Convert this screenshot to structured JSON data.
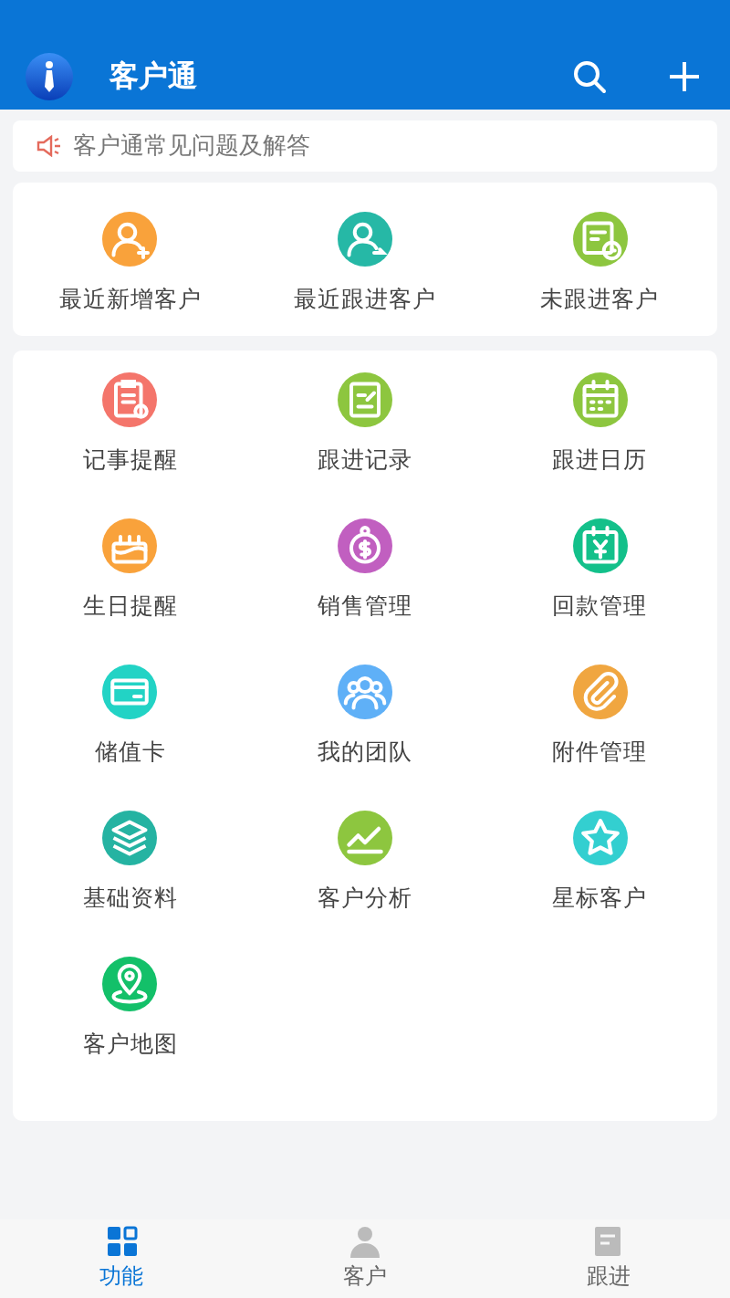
{
  "app_bar": {
    "title": "客户通"
  },
  "notice": {
    "text": "客户通常见问题及解答"
  },
  "quick_items": [
    {
      "label": "最近新增客户",
      "color": "#f9a23b"
    },
    {
      "label": "最近跟进客户",
      "color": "#26b8a6"
    },
    {
      "label": "未跟进客户",
      "color": "#8dc63f"
    }
  ],
  "feature_items": [
    {
      "label": "记事提醒",
      "color": "#f4756b"
    },
    {
      "label": "跟进记录",
      "color": "#8dc63f"
    },
    {
      "label": "跟进日历",
      "color": "#8dc63f"
    },
    {
      "label": "生日提醒",
      "color": "#f9a23b"
    },
    {
      "label": "销售管理",
      "color": "#c15fc0"
    },
    {
      "label": "回款管理",
      "color": "#13c08a"
    },
    {
      "label": "储值卡",
      "color": "#22d3c5"
    },
    {
      "label": "我的团队",
      "color": "#5fb0f7"
    },
    {
      "label": "附件管理",
      "color": "#f0a640"
    },
    {
      "label": "基础资料",
      "color": "#25b3a2"
    },
    {
      "label": "客户分析",
      "color": "#8dc63f"
    },
    {
      "label": "星标客户",
      "color": "#33cfd0"
    },
    {
      "label": "客户地图",
      "color": "#13c069"
    }
  ],
  "tab_bar": [
    {
      "label": "功能",
      "selected": true
    },
    {
      "label": "客户",
      "selected": false
    },
    {
      "label": "跟进",
      "selected": false
    }
  ]
}
